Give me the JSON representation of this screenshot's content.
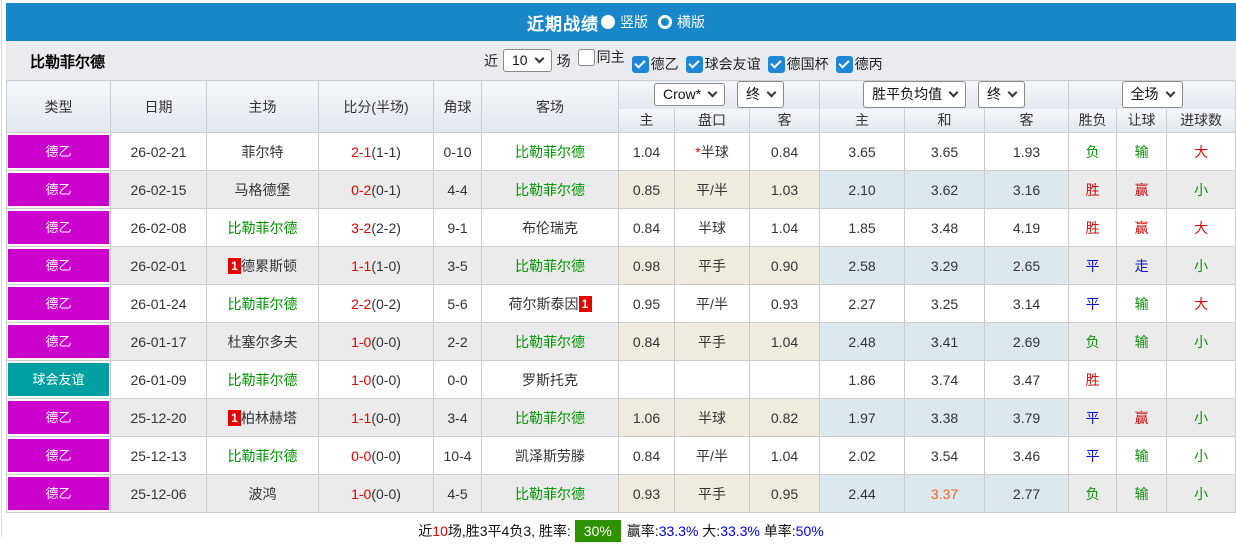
{
  "titlebar": {
    "title": "近期战绩",
    "vertical_label": "竖版",
    "horizontal_label": "横版",
    "topbar_color": "#1787c9"
  },
  "filterbar": {
    "team": "比勒菲尔德",
    "near_label": "近",
    "count_value": "10",
    "games_label": "场",
    "checkboxes": [
      {
        "label": "同主",
        "checked": false
      },
      {
        "label": "德乙",
        "checked": true
      },
      {
        "label": "球会友谊",
        "checked": true
      },
      {
        "label": "德国杯",
        "checked": true
      },
      {
        "label": "德丙",
        "checked": true
      }
    ]
  },
  "table": {
    "col_headers": [
      "类型",
      "日期",
      "主场",
      "比分(半场)",
      "角球",
      "客场"
    ],
    "selects": {
      "odds_source": "Crow*",
      "odds_final": "终",
      "mean_source": "胜平负均值",
      "mean_final": "终",
      "scope": "全场"
    },
    "sub_headers": [
      "主",
      "盘口",
      "客",
      "主",
      "和",
      "客",
      "胜负",
      "让球",
      "进球数"
    ],
    "type_colors": {
      "league": "#cc00cc",
      "friendly": "#00a0a2"
    },
    "rows": [
      {
        "type": "德乙",
        "type_bg": "#cc00cc",
        "date": "26-02-21",
        "home": {
          "name": "菲尔特",
          "green": false
        },
        "score": {
          "ft": "2-1",
          "ht": "(1-1)"
        },
        "corner": "0-10",
        "away": {
          "name": "比勒菲尔德",
          "green": true
        },
        "odds": {
          "home": "1.04",
          "star": true,
          "line": "半球",
          "away": "0.84"
        },
        "mean": {
          "home": "3.65",
          "draw": "3.65",
          "away": "1.93",
          "orange": false
        },
        "res": {
          "t": "负",
          "c": "green"
        },
        "let": {
          "t": "输",
          "c": "green"
        },
        "goal": {
          "t": "大",
          "c": "red"
        }
      },
      {
        "type": "德乙",
        "type_bg": "#cc00cc",
        "date": "26-02-15",
        "home": {
          "name": "马格德堡",
          "green": false
        },
        "score": {
          "ft": "0-2",
          "ht": "(0-1)"
        },
        "corner": "4-4",
        "away": {
          "name": "比勒菲尔德",
          "green": true
        },
        "odds": {
          "home": "0.85",
          "star": false,
          "line": "平/半",
          "away": "1.03"
        },
        "mean": {
          "home": "2.10",
          "draw": "3.62",
          "away": "3.16",
          "orange": false
        },
        "res": {
          "t": "胜",
          "c": "red"
        },
        "let": {
          "t": "赢",
          "c": "red"
        },
        "goal": {
          "t": "小",
          "c": "green"
        }
      },
      {
        "type": "德乙",
        "type_bg": "#cc00cc",
        "date": "26-02-08",
        "home": {
          "name": "比勒菲尔德",
          "green": true
        },
        "score": {
          "ft": "3-2",
          "ht": "(2-2)"
        },
        "corner": "9-1",
        "away": {
          "name": "布伦瑞克",
          "green": false
        },
        "odds": {
          "home": "0.84",
          "star": false,
          "line": "半球",
          "away": "1.04"
        },
        "mean": {
          "home": "1.85",
          "draw": "3.48",
          "away": "4.19",
          "orange": false
        },
        "res": {
          "t": "胜",
          "c": "red"
        },
        "let": {
          "t": "赢",
          "c": "red"
        },
        "goal": {
          "t": "大",
          "c": "red"
        }
      },
      {
        "type": "德乙",
        "type_bg": "#cc00cc",
        "date": "26-02-01",
        "home": {
          "name": "德累斯顿",
          "green": false,
          "badge": "1",
          "badge_pos": "before"
        },
        "score": {
          "ft": "1-1",
          "ht": "(1-0)"
        },
        "corner": "3-5",
        "away": {
          "name": "比勒菲尔德",
          "green": true
        },
        "odds": {
          "home": "0.98",
          "star": false,
          "line": "平手",
          "away": "0.90"
        },
        "mean": {
          "home": "2.58",
          "draw": "3.29",
          "away": "2.65",
          "orange": false
        },
        "res": {
          "t": "平",
          "c": "blue"
        },
        "let": {
          "t": "走",
          "c": "blue"
        },
        "goal": {
          "t": "小",
          "c": "green"
        }
      },
      {
        "type": "德乙",
        "type_bg": "#cc00cc",
        "date": "26-01-24",
        "home": {
          "name": "比勒菲尔德",
          "green": true
        },
        "score": {
          "ft": "2-2",
          "ht": "(0-2)"
        },
        "corner": "5-6",
        "away": {
          "name": "荷尔斯泰因",
          "green": false,
          "badge": "1",
          "badge_pos": "after"
        },
        "odds": {
          "home": "0.95",
          "star": false,
          "line": "平/半",
          "away": "0.93"
        },
        "mean": {
          "home": "2.27",
          "draw": "3.25",
          "away": "3.14",
          "orange": false
        },
        "res": {
          "t": "平",
          "c": "blue"
        },
        "let": {
          "t": "输",
          "c": "green"
        },
        "goal": {
          "t": "大",
          "c": "red"
        }
      },
      {
        "type": "德乙",
        "type_bg": "#cc00cc",
        "date": "26-01-17",
        "home": {
          "name": "杜塞尔多夫",
          "green": false
        },
        "score": {
          "ft": "1-0",
          "ht": "(0-0)"
        },
        "corner": "2-2",
        "away": {
          "name": "比勒菲尔德",
          "green": true
        },
        "odds": {
          "home": "0.84",
          "star": false,
          "line": "平手",
          "away": "1.04"
        },
        "mean": {
          "home": "2.48",
          "draw": "3.41",
          "away": "2.69",
          "orange": false
        },
        "res": {
          "t": "负",
          "c": "green"
        },
        "let": {
          "t": "输",
          "c": "green"
        },
        "goal": {
          "t": "小",
          "c": "green"
        }
      },
      {
        "type": "球会友谊",
        "type_bg": "#00a0a2",
        "date": "26-01-09",
        "home": {
          "name": "比勒菲尔德",
          "green": true
        },
        "score": {
          "ft": "1-0",
          "ht": "(0-0)"
        },
        "corner": "0-0",
        "away": {
          "name": "罗斯托克",
          "green": false
        },
        "odds": {
          "home": "",
          "star": false,
          "line": "",
          "away": ""
        },
        "mean": {
          "home": "1.86",
          "draw": "3.74",
          "away": "3.47",
          "orange": false
        },
        "res": {
          "t": "胜",
          "c": "red"
        },
        "let": {
          "t": "",
          "c": ""
        },
        "goal": {
          "t": "",
          "c": ""
        }
      },
      {
        "type": "德乙",
        "type_bg": "#cc00cc",
        "date": "25-12-20",
        "home": {
          "name": "柏林赫塔",
          "green": false,
          "badge": "1",
          "badge_pos": "before"
        },
        "score": {
          "ft": "1-1",
          "ht": "(0-0)"
        },
        "corner": "3-4",
        "away": {
          "name": "比勒菲尔德",
          "green": true
        },
        "odds": {
          "home": "1.06",
          "star": false,
          "line": "半球",
          "away": "0.82"
        },
        "mean": {
          "home": "1.97",
          "draw": "3.38",
          "away": "3.79",
          "orange": false
        },
        "res": {
          "t": "平",
          "c": "blue"
        },
        "let": {
          "t": "赢",
          "c": "red"
        },
        "goal": {
          "t": "小",
          "c": "green"
        }
      },
      {
        "type": "德乙",
        "type_bg": "#cc00cc",
        "date": "25-12-13",
        "home": {
          "name": "比勒菲尔德",
          "green": true
        },
        "score": {
          "ft": "0-0",
          "ht": "(0-0)"
        },
        "corner": "10-4",
        "away": {
          "name": "凯泽斯劳滕",
          "green": false
        },
        "odds": {
          "home": "0.84",
          "star": false,
          "line": "平/半",
          "away": "1.04"
        },
        "mean": {
          "home": "2.02",
          "draw": "3.54",
          "away": "3.46",
          "orange": false
        },
        "res": {
          "t": "平",
          "c": "blue"
        },
        "let": {
          "t": "输",
          "c": "green"
        },
        "goal": {
          "t": "小",
          "c": "green"
        }
      },
      {
        "type": "德乙",
        "type_bg": "#cc00cc",
        "date": "25-12-06",
        "home": {
          "name": "波鸿",
          "green": false
        },
        "score": {
          "ft": "1-0",
          "ht": "(0-0)"
        },
        "corner": "4-5",
        "away": {
          "name": "比勒菲尔德",
          "green": true
        },
        "odds": {
          "home": "0.93",
          "star": false,
          "line": "平手",
          "away": "0.95"
        },
        "mean": {
          "home": "2.44",
          "draw": "3.37",
          "away": "2.77",
          "orange": true
        },
        "res": {
          "t": "负",
          "c": "green"
        },
        "let": {
          "t": "输",
          "c": "green"
        },
        "goal": {
          "t": "小",
          "c": "green"
        }
      }
    ]
  },
  "summary": {
    "segments": [
      {
        "t": "近",
        "c": ""
      },
      {
        "t": "10",
        "c": "red"
      },
      {
        "t": "场,胜3平4负3, 胜率:",
        "c": ""
      },
      {
        "t": "30%",
        "c": "pct"
      },
      {
        "t": "赢率:",
        "c": ""
      },
      {
        "t": "33.3%",
        "c": "blue"
      },
      {
        "t": " 大:",
        "c": ""
      },
      {
        "t": "33.3%",
        "c": "blue"
      },
      {
        "t": " 单率:",
        "c": ""
      },
      {
        "t": "50%",
        "c": "blue"
      }
    ]
  }
}
